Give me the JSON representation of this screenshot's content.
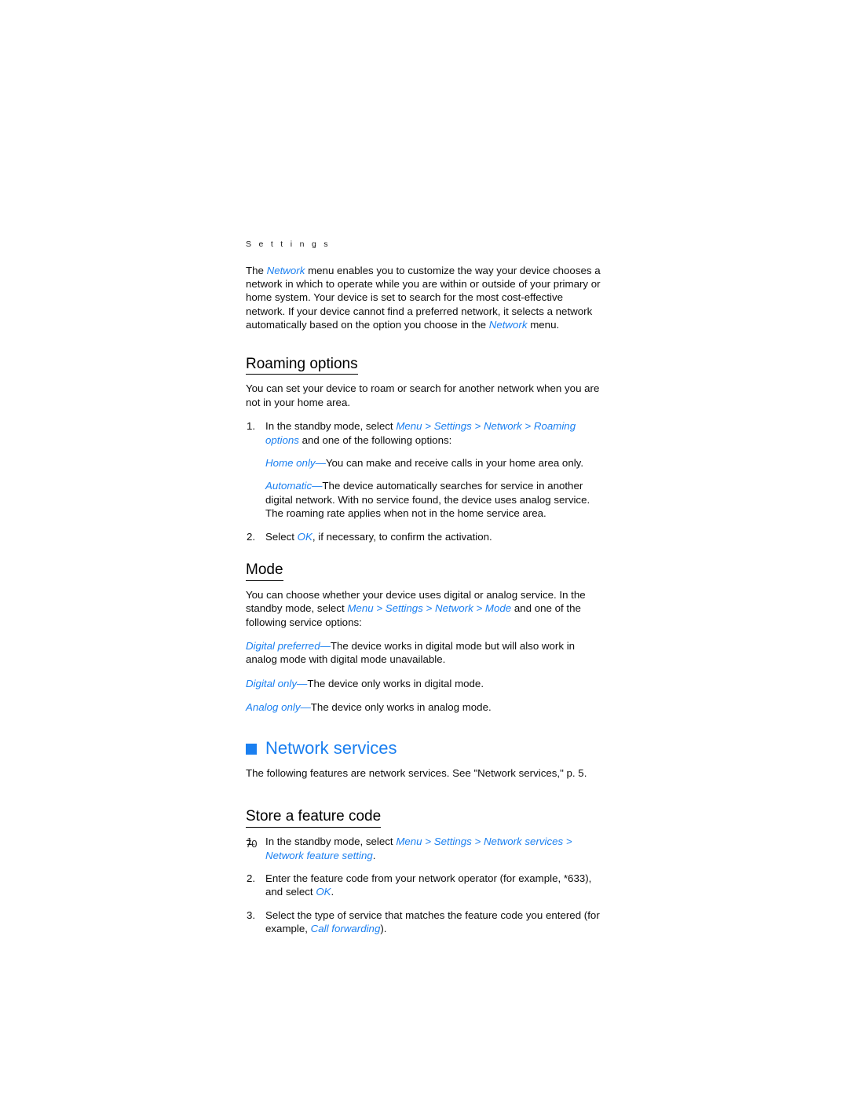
{
  "document": {
    "running_header": "S e t t i n g s",
    "page_number": "70",
    "accent_color": "#1a7ff0",
    "text_color": "#0d0d0d"
  },
  "intro": {
    "p1_a": "The ",
    "p1_term": "Network",
    "p1_b": " menu enables you to customize the way your device chooses a network in which to operate while you are within or outside of your primary or home system. Your device is set to search for the most cost-effective network. If your device cannot find a preferred network, it selects a network automatically based on the option you choose in the ",
    "p1_term2": "Network",
    "p1_c": " menu."
  },
  "roaming": {
    "heading": "Roaming options",
    "intro": "You can set your device to roam or search for another network when you are not in your home area.",
    "steps": [
      {
        "num": "1.",
        "text_a": "In the standby mode, select ",
        "path": [
          "Menu",
          "Settings",
          "Network",
          "Roaming options"
        ],
        "text_b": " and one of the following options:"
      },
      {
        "num": "2.",
        "text_a": "Select ",
        "term": "OK",
        "text_b": ", if necessary, to confirm the activation."
      }
    ],
    "options": [
      {
        "term": "Home only",
        "dash": "—",
        "desc": "You can make and receive calls in your home area only."
      },
      {
        "term": "Automatic",
        "dash": "—",
        "desc": "The device automatically searches for service in another digital network. With no service found, the device uses analog service. The roaming rate applies when not in the home service area."
      }
    ]
  },
  "mode": {
    "heading": "Mode",
    "intro_a": "You can choose whether your device uses digital or analog service. In the standby mode, select ",
    "path": [
      "Menu",
      "Settings",
      "Network",
      "Mode"
    ],
    "intro_b": " and one of the following service options:",
    "options": [
      {
        "term": "Digital preferred",
        "dash": "—",
        "desc": "The device works in digital mode but will also work in analog mode with digital mode unavailable."
      },
      {
        "term": "Digital only",
        "dash": "—",
        "desc": "The device only works in digital mode."
      },
      {
        "term": "Analog only",
        "dash": "—",
        "desc": "The device only works in analog mode."
      }
    ]
  },
  "network_services": {
    "heading": "Network services",
    "intro": "The following features are network services. See \"Network services,\" p. 5."
  },
  "feature_code": {
    "heading": "Store a feature code",
    "steps": [
      {
        "num": "1.",
        "text_a": "In the standby mode, select ",
        "path": [
          "Menu",
          "Settings",
          "Network services",
          "Network feature setting"
        ],
        "text_b": "."
      },
      {
        "num": "2.",
        "text_a": "Enter the feature code from your network operator (for example, *633), and select ",
        "term": "OK",
        "text_b": "."
      },
      {
        "num": "3.",
        "text_a": "Select the type of service that matches the feature code you entered (for example, ",
        "term": "Call forwarding",
        "text_b": ")."
      }
    ]
  }
}
